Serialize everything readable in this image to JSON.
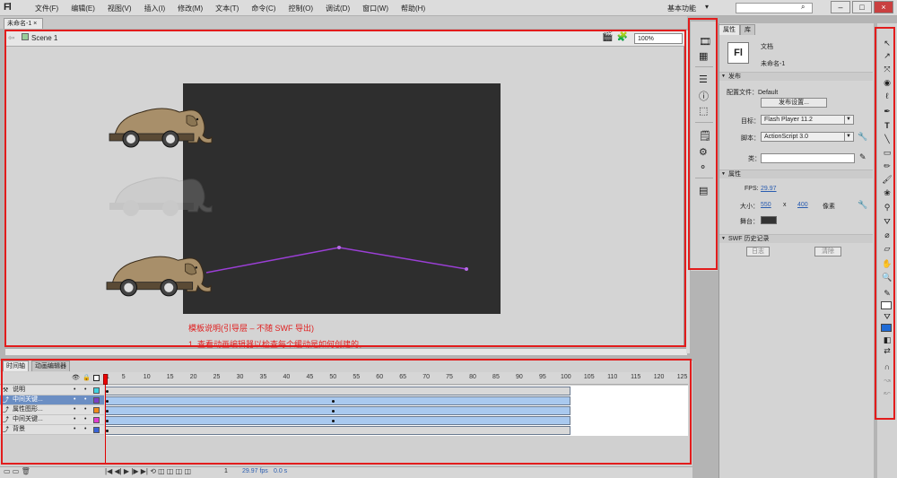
{
  "app": {
    "logo": "Fl",
    "menus": [
      "文件(F)",
      "编辑(E)",
      "视图(V)",
      "插入(I)",
      "修改(M)",
      "文本(T)",
      "命令(C)",
      "控制(O)",
      "调试(D)",
      "窗口(W)",
      "帮助(H)"
    ],
    "workspace": "基本功能",
    "window_buttons": [
      "–",
      "□",
      "×"
    ]
  },
  "document_tab": "未命名-1 ×",
  "editbar": {
    "scene": "Scene 1",
    "zoom": "100%"
  },
  "stage": {
    "guide_title": "模板说明(引导层 – 不随 SWF 导出)",
    "guide_line1": "1. 查看动画编辑器以检查每个缓动是如何创建的。"
  },
  "timeline": {
    "tabs": [
      "时间轴",
      "动画编辑器"
    ],
    "ruler": [
      "1",
      "5",
      "10",
      "15",
      "20",
      "25",
      "30",
      "35",
      "40",
      "45",
      "50",
      "55",
      "60",
      "65",
      "70",
      "75",
      "80",
      "85",
      "90",
      "95",
      "100",
      "105",
      "110",
      "115",
      "120",
      "125"
    ],
    "layers": [
      {
        "name": "说明",
        "color": "#3fd0e0",
        "selected": false
      },
      {
        "name": "中间关键...",
        "color": "#7a3ec8",
        "selected": true
      },
      {
        "name": "属性图形...",
        "color": "#f08a1a",
        "selected": false
      },
      {
        "name": "中间关键...",
        "color": "#e03ed0",
        "selected": false
      },
      {
        "name": "背景",
        "color": "#3a64d8",
        "selected": false
      }
    ],
    "current_frame": "1",
    "fps": "29.97 fps",
    "time": "0.0 s"
  },
  "properties": {
    "tabs": [
      "属性",
      "库"
    ],
    "doc_icon": "Fl",
    "doc_type": "文档",
    "doc_name": "未命名-1",
    "publish_section": "发布",
    "profile_label": "配置文件：Default",
    "publish_settings_button": "发布设置...",
    "target_label": "目标：",
    "target_value": "Flash Player 11.2",
    "script_label": "脚本：",
    "script_value": "ActionScript 3.0",
    "class_label": "类：",
    "properties_section": "属性",
    "fps_label": "FPS:",
    "fps_value": "29.97",
    "size_label": "大小：",
    "width": "550",
    "x": "x",
    "height": "400",
    "unit": "像素",
    "stage_label": "舞台：",
    "stage_color": "#333333",
    "swf_history_section": "SWF 历史记录",
    "log_button": "日志",
    "clear_button": "清除"
  },
  "colors": {
    "highlight": "#e21c1c",
    "motion_path": "#9b3fd6",
    "fill": "#1f6bd6"
  }
}
